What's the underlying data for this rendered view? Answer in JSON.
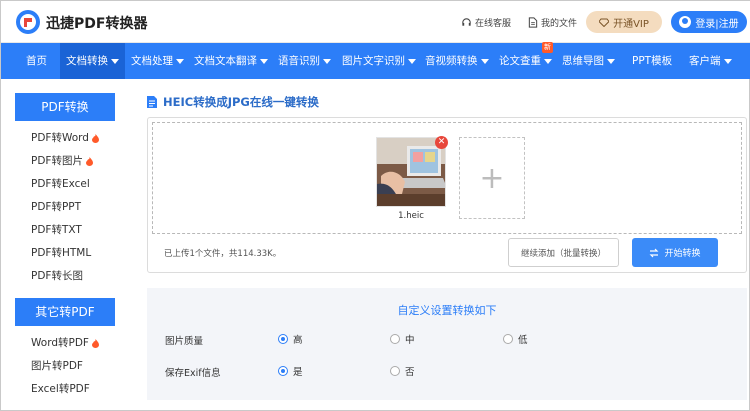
{
  "header": {
    "brand": "迅捷PDF转换器",
    "service": "在线客服",
    "files": "我的文件",
    "vip": "开通VIP",
    "login": "登录|注册"
  },
  "nav": {
    "items": [
      {
        "label": "首页",
        "caret": false
      },
      {
        "label": "文档转换",
        "caret": true,
        "active": true
      },
      {
        "label": "文档处理",
        "caret": true
      },
      {
        "label": "文档文本翻译",
        "caret": true
      },
      {
        "label": "语音识别",
        "caret": true
      },
      {
        "label": "图片文字识别",
        "caret": true
      },
      {
        "label": "音视频转换",
        "caret": true
      },
      {
        "label": "论文查重",
        "caret": true,
        "badge": "新"
      },
      {
        "label": "思维导图",
        "caret": true
      },
      {
        "label": "PPT模板",
        "caret": false
      },
      {
        "label": "客户端",
        "caret": true
      }
    ]
  },
  "sidebar": {
    "group1": {
      "title": "PDF转换",
      "items": [
        {
          "label": "PDF转Word",
          "hot": true
        },
        {
          "label": "PDF转图片",
          "hot": true
        },
        {
          "label": "PDF转Excel",
          "hot": false
        },
        {
          "label": "PDF转PPT",
          "hot": false
        },
        {
          "label": "PDF转TXT",
          "hot": false
        },
        {
          "label": "PDF转HTML",
          "hot": false
        },
        {
          "label": "PDF转长图",
          "hot": false
        }
      ]
    },
    "group2": {
      "title": "其它转PDF",
      "items": [
        {
          "label": "Word转PDF",
          "hot": true
        },
        {
          "label": "图片转PDF",
          "hot": false
        },
        {
          "label": "Excel转PDF",
          "hot": false
        }
      ]
    }
  },
  "main": {
    "title": "HEIC转换成JPG在线一键转换",
    "file_name": "1.heic",
    "status": "已上传1个文件，共114.33K。",
    "continue_label": "继续添加（批量转换）",
    "start_label": "开始转换"
  },
  "settings": {
    "title": "自定义设置转换如下",
    "quality_label": "图片质量",
    "quality_options": [
      "高",
      "中",
      "低"
    ],
    "quality_selected": "高",
    "exif_label": "保存Exif信息",
    "exif_options": [
      "是",
      "否"
    ],
    "exif_selected": "是"
  },
  "colors": {
    "primary": "#2c7ef8",
    "nav_active": "#1a63d6",
    "vip_bg": "#f4dcbf",
    "hot": "#ff5a2a",
    "delete": "#e8473b"
  }
}
